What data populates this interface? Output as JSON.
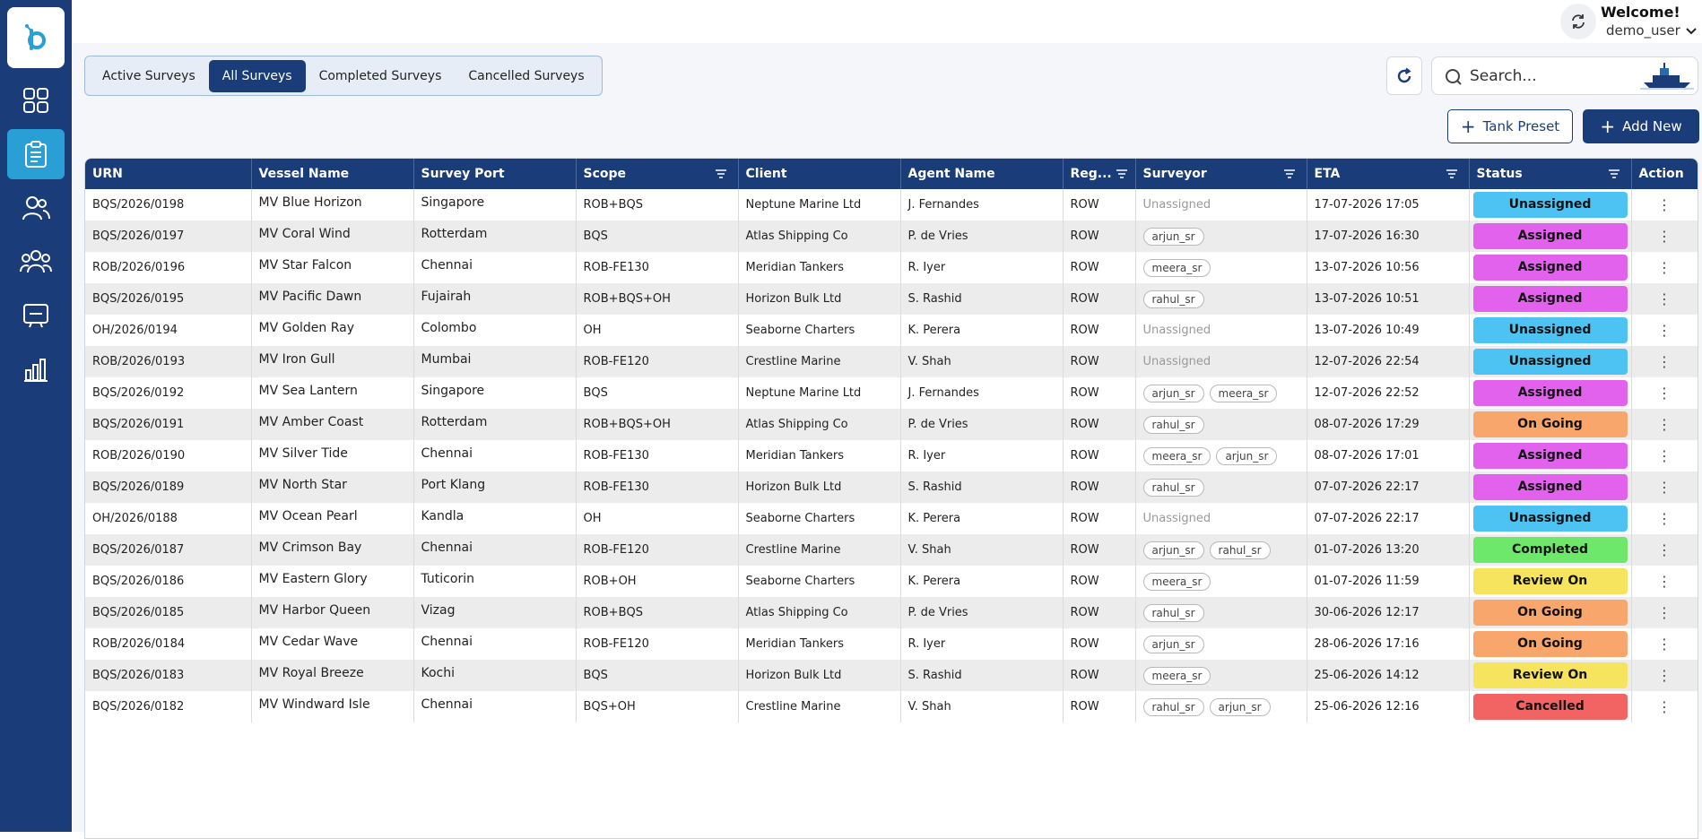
{
  "sidebar": {
    "items": [
      {
        "icon": "dashboard-icon"
      },
      {
        "icon": "clipboard-icon",
        "active": true
      },
      {
        "icon": "users-icon"
      },
      {
        "icon": "group-icon"
      },
      {
        "icon": "monitor-icon"
      },
      {
        "icon": "bar-chart-icon"
      }
    ]
  },
  "header": {
    "welcome": "Welcome!",
    "username": "demo_user"
  },
  "tabs": [
    {
      "label": "Active Surveys"
    },
    {
      "label": "All Surveys",
      "active": true
    },
    {
      "label": "Completed Surveys"
    },
    {
      "label": "Cancelled Surveys"
    }
  ],
  "search": {
    "placeholder": "Search..."
  },
  "buttons": {
    "tank_preset": "Tank Preset",
    "add_new": "Add New"
  },
  "table": {
    "columns": [
      "URN",
      "Vessel Name",
      "Survey Port",
      "Scope",
      "Client",
      "Agent Name",
      "Reg...",
      "Surveyor",
      "ETA",
      "Status",
      "Action"
    ],
    "unassigned_label": "Unassigned",
    "action_glyph": "⋮",
    "rows": [
      {
        "urn": "BQS/2026/0198",
        "vessel": "MV Blue Horizon",
        "port": "Singapore",
        "scope": "ROB+BQS",
        "client": "Neptune Marine Ltd",
        "agent": "J. Fernandes",
        "reg": "ROW",
        "surveyors": [],
        "eta": "17-07-2026 17:05",
        "status": "Unassigned"
      },
      {
        "urn": "BQS/2026/0197",
        "vessel": "MV Coral Wind",
        "port": "Rotterdam",
        "scope": "BQS",
        "client": "Atlas Shipping Co",
        "agent": "P. de Vries",
        "reg": "ROW",
        "surveyors": [
          "arjun_sr"
        ],
        "eta": "17-07-2026 16:30",
        "status": "Assigned"
      },
      {
        "urn": "ROB/2026/0196",
        "vessel": "MV Star Falcon",
        "port": "Chennai",
        "scope": "ROB-FE130",
        "client": "Meridian Tankers",
        "agent": "R. Iyer",
        "reg": "ROW",
        "surveyors": [
          "meera_sr"
        ],
        "eta": "13-07-2026 10:56",
        "status": "Assigned"
      },
      {
        "urn": "BQS/2026/0195",
        "vessel": "MV Pacific Dawn",
        "port": "Fujairah",
        "scope": "ROB+BQS+OH",
        "client": "Horizon Bulk Ltd",
        "agent": "S. Rashid",
        "reg": "ROW",
        "surveyors": [
          "rahul_sr"
        ],
        "eta": "13-07-2026 10:51",
        "status": "Assigned"
      },
      {
        "urn": "OH/2026/0194",
        "vessel": "MV Golden Ray",
        "port": "Colombo",
        "scope": "OH",
        "client": "Seaborne Charters",
        "agent": "K. Perera",
        "reg": "ROW",
        "surveyors": [],
        "eta": "13-07-2026 10:49",
        "status": "Unassigned"
      },
      {
        "urn": "ROB/2026/0193",
        "vessel": "MV Iron Gull",
        "port": "Mumbai",
        "scope": "ROB-FE120",
        "client": "Crestline Marine",
        "agent": "V. Shah",
        "reg": "ROW",
        "surveyors": [],
        "eta": "12-07-2026 22:54",
        "status": "Unassigned"
      },
      {
        "urn": "BQS/2026/0192",
        "vessel": "MV Sea Lantern",
        "port": "Singapore",
        "scope": "BQS",
        "client": "Neptune Marine Ltd",
        "agent": "J. Fernandes",
        "reg": "ROW",
        "surveyors": [
          "arjun_sr",
          "meera_sr"
        ],
        "eta": "12-07-2026 22:52",
        "status": "Assigned"
      },
      {
        "urn": "BQS/2026/0191",
        "vessel": "MV Amber Coast",
        "port": "Rotterdam",
        "scope": "ROB+BQS+OH",
        "client": "Atlas Shipping Co",
        "agent": "P. de Vries",
        "reg": "ROW",
        "surveyors": [
          "rahul_sr"
        ],
        "eta": "08-07-2026 17:29",
        "status": "On Going"
      },
      {
        "urn": "ROB/2026/0190",
        "vessel": "MV Silver Tide",
        "port": "Chennai",
        "scope": "ROB-FE130",
        "client": "Meridian Tankers",
        "agent": "R. Iyer",
        "reg": "ROW",
        "surveyors": [
          "meera_sr",
          "arjun_sr"
        ],
        "eta": "08-07-2026 17:01",
        "status": "Assigned"
      },
      {
        "urn": "BQS/2026/0189",
        "vessel": "MV North Star",
        "port": "Port Klang",
        "scope": "ROB-FE130",
        "client": "Horizon Bulk Ltd",
        "agent": "S. Rashid",
        "reg": "ROW",
        "surveyors": [
          "rahul_sr"
        ],
        "eta": "07-07-2026 22:17",
        "status": "Assigned"
      },
      {
        "urn": "OH/2026/0188",
        "vessel": "MV Ocean Pearl",
        "port": "Kandla",
        "scope": "OH",
        "client": "Seaborne Charters",
        "agent": "K. Perera",
        "reg": "ROW",
        "surveyors": [],
        "eta": "07-07-2026 22:17",
        "status": "Unassigned"
      },
      {
        "urn": "BQS/2026/0187",
        "vessel": "MV Crimson Bay",
        "port": "Chennai",
        "scope": "ROB-FE120",
        "client": "Crestline Marine",
        "agent": "V. Shah",
        "reg": "ROW",
        "surveyors": [
          "arjun_sr",
          "rahul_sr"
        ],
        "eta": "01-07-2026 13:20",
        "status": "Completed"
      },
      {
        "urn": "BQS/2026/0186",
        "vessel": "MV Eastern Glory",
        "port": "Tuticorin",
        "scope": "ROB+OH",
        "client": "Seaborne Charters",
        "agent": "K. Perera",
        "reg": "ROW",
        "surveyors": [
          "meera_sr"
        ],
        "eta": "01-07-2026 11:59",
        "status": "Review On"
      },
      {
        "urn": "BQS/2026/0185",
        "vessel": "MV Harbor Queen",
        "port": "Vizag",
        "scope": "ROB+BQS",
        "client": "Atlas Shipping Co",
        "agent": "P. de Vries",
        "reg": "ROW",
        "surveyors": [
          "rahul_sr"
        ],
        "eta": "30-06-2026 12:17",
        "status": "On Going"
      },
      {
        "urn": "ROB/2026/0184",
        "vessel": "MV Cedar Wave",
        "port": "Chennai",
        "scope": "ROB-FE120",
        "client": "Meridian Tankers",
        "agent": "R. Iyer",
        "reg": "ROW",
        "surveyors": [
          "arjun_sr"
        ],
        "eta": "28-06-2026 17:16",
        "status": "On Going"
      },
      {
        "urn": "BQS/2026/0183",
        "vessel": "MV Royal Breeze",
        "port": "Kochi",
        "scope": "BQS",
        "client": "Horizon Bulk Ltd",
        "agent": "S. Rashid",
        "reg": "ROW",
        "surveyors": [
          "meera_sr"
        ],
        "eta": "25-06-2026 14:12",
        "status": "Review On"
      },
      {
        "urn": "BQS/2026/0182",
        "vessel": "MV Windward Isle",
        "port": "Chennai",
        "scope": "BQS+OH",
        "client": "Crestline Marine",
        "agent": "V. Shah",
        "reg": "ROW",
        "surveyors": [
          "rahul_sr",
          "arjun_sr"
        ],
        "eta": "25-06-2026 12:16",
        "status": "Cancelled"
      }
    ]
  },
  "status_colors": {
    "Unassigned": "#4cc3f2",
    "Assigned": "#e262ee",
    "On Going": "#f9a66c",
    "Completed": "#6ee86a",
    "Review On": "#f6e35e",
    "Cancelled": "#f26464"
  },
  "colors": {
    "brand": "#1a3d7a",
    "accent": "#2a9fd6"
  }
}
